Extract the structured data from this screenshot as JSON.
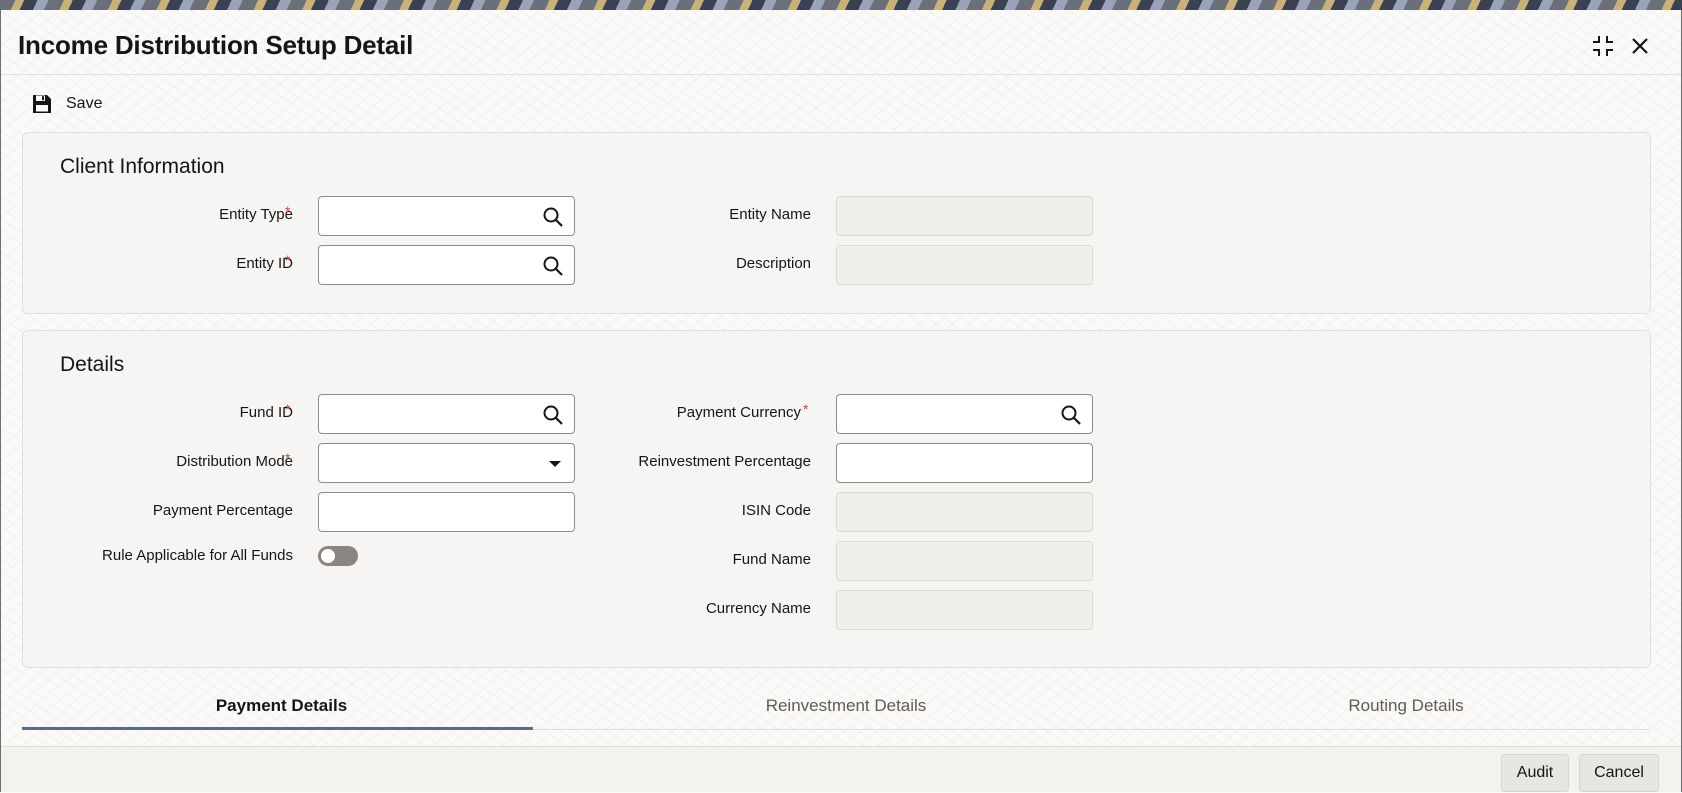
{
  "window": {
    "title": "Income Distribution Setup Detail",
    "maximize_icon": "maximize-icon",
    "close_icon": "close-icon"
  },
  "toolbar": {
    "save_label": "Save",
    "save_icon": "floppy-disk-icon"
  },
  "client_information": {
    "heading": "Client Information",
    "entity_type": {
      "label": "Entity Type",
      "required": "*",
      "value": ""
    },
    "entity_id": {
      "label": "Entity ID",
      "required": "*",
      "value": ""
    },
    "entity_name": {
      "label": "Entity Name",
      "value": ""
    },
    "description": {
      "label": "Description",
      "value": ""
    }
  },
  "details": {
    "heading": "Details",
    "fund_id": {
      "label": "Fund ID",
      "required": "*",
      "value": ""
    },
    "distribution_mode": {
      "label": "Distribution Mode",
      "required": "*",
      "value": ""
    },
    "payment_percentage": {
      "label": "Payment Percentage",
      "value": ""
    },
    "rule_applicable": {
      "label": "Rule Applicable for All Funds",
      "on": false
    },
    "payment_currency": {
      "label": "Payment Currency",
      "required": "*",
      "value": ""
    },
    "reinvestment_percentage": {
      "label": "Reinvestment Percentage",
      "value": ""
    },
    "isin_code": {
      "label": "ISIN Code",
      "value": ""
    },
    "fund_name": {
      "label": "Fund Name",
      "value": ""
    },
    "currency_name": {
      "label": "Currency Name",
      "value": ""
    }
  },
  "tabs": [
    {
      "label": "Payment Details",
      "active": true
    },
    {
      "label": "Reinvestment Details",
      "active": false
    },
    {
      "label": "Routing Details",
      "active": false
    }
  ],
  "footer": {
    "audit_label": "Audit",
    "cancel_label": "Cancel"
  },
  "colors": {
    "required_marker": "#c74634",
    "active_tab_underline": "#5a6b82"
  }
}
